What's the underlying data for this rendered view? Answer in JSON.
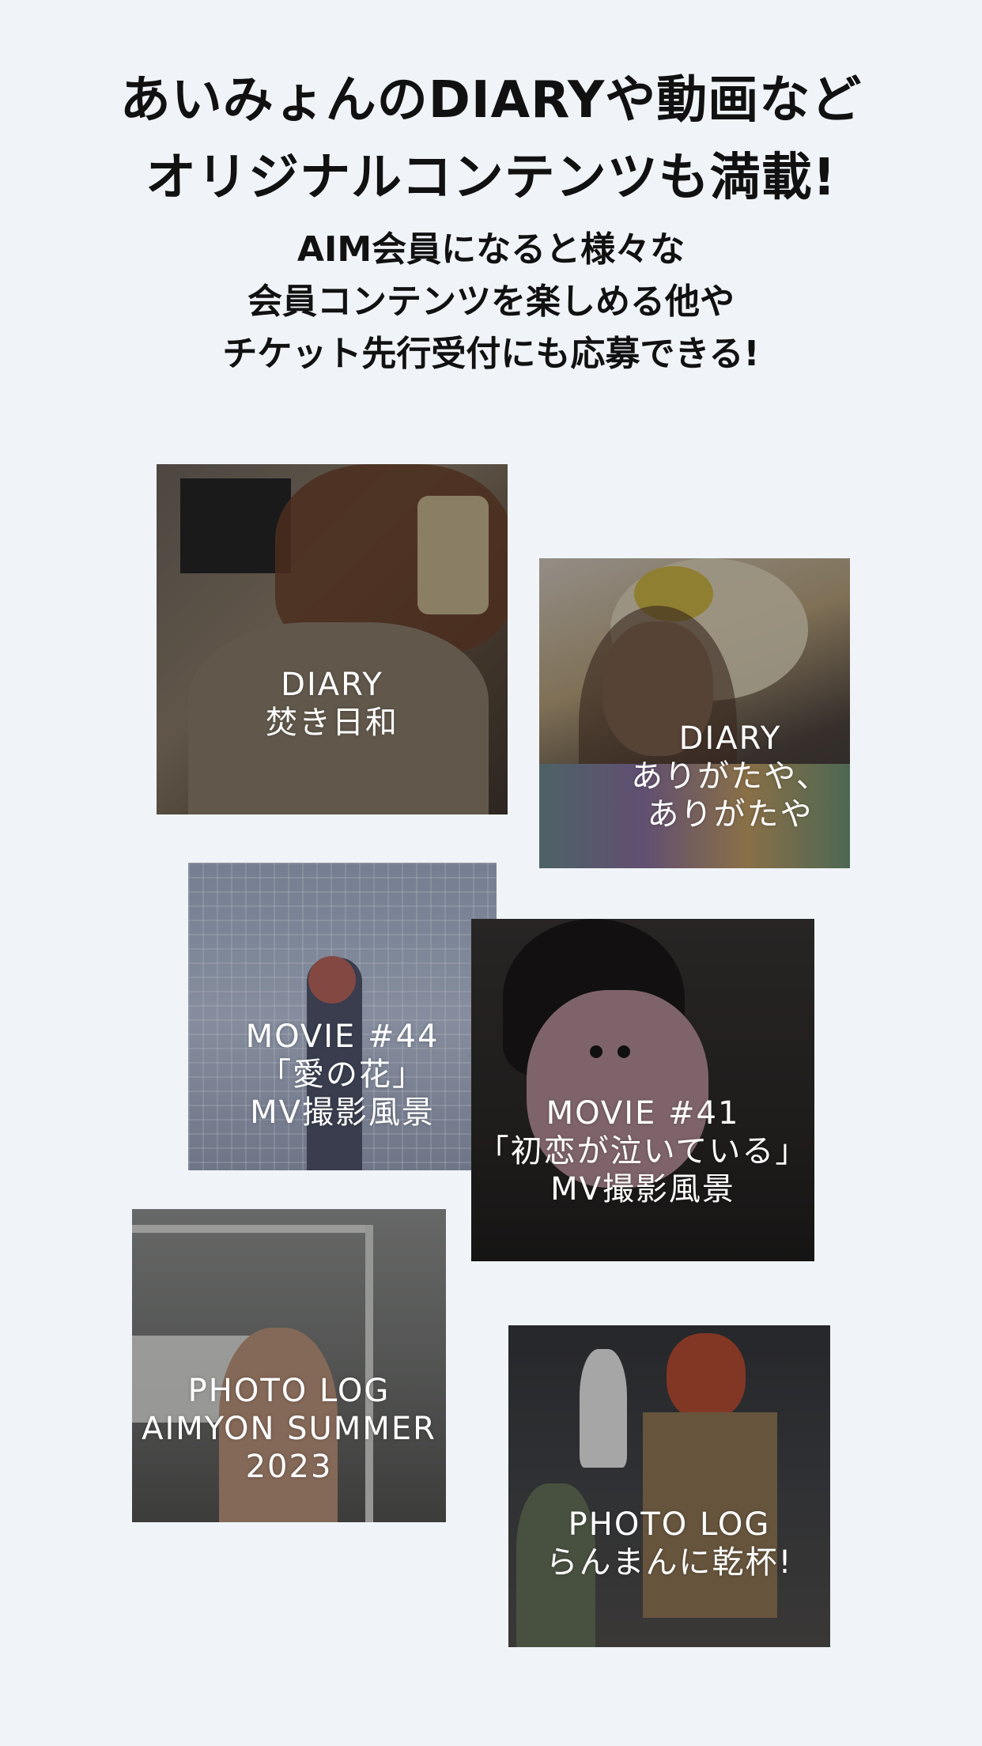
{
  "headline": {
    "line1": "あいみょんのDIARYや動画など",
    "line2": "オリジナルコンテンツも満載!"
  },
  "subtext": {
    "line1": "AIM会員になると様々な",
    "line2": "会員コンテンツを楽しめる他や",
    "line3": "チケット先行受付にも応募できる!"
  },
  "cards": [
    {
      "line1": "DIARY",
      "line2": "焚き日和"
    },
    {
      "line1": "DIARY",
      "line2": "ありがたや、",
      "line3": "ありがたや"
    },
    {
      "line1": "MOVIE #44",
      "line2": "「愛の花」",
      "line3": "MV撮影風景"
    },
    {
      "line1": "MOVIE #41",
      "line2": "「初恋が泣いている」",
      "line3": "MV撮影風景"
    },
    {
      "line1": "PHOTO LOG",
      "line2": "AIMYON SUMMER",
      "line3": "2023"
    },
    {
      "line1": "PHOTO LOG",
      "line2": "らんまんに乾杯!"
    }
  ],
  "colors": {
    "background": "#f0f4f8",
    "headline_text": "#111111",
    "card_text": "#ffffff"
  }
}
